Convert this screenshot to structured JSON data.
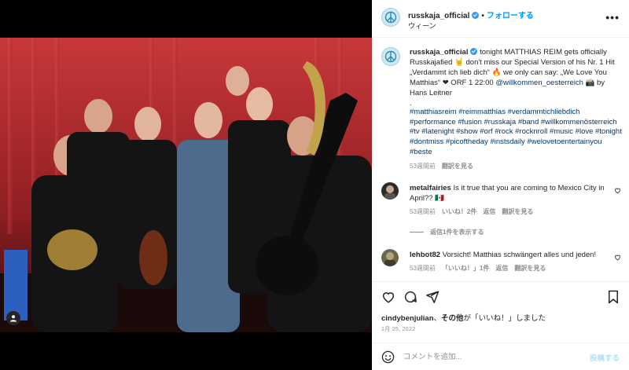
{
  "header": {
    "username": "russkaja_official",
    "follow_label": "フォローする",
    "location": "ウィーン",
    "more_label": "•••"
  },
  "caption": {
    "username": "russkaja_official",
    "text1": "tonight MATTHIAS REIM gets officially Russkajafied 🤘 don't miss our Special Version of his Nr. 1 Hit „Verdammt ich lieb dich“ 🔥 we only can say: „We Love You Matthias“ ❤ ORF 1 22:00 ",
    "mention": "@willkommen_oesterreich",
    "text2": " 📸 by Hans Leitner",
    "dot": ".",
    "hashtags": "#matthiasreim #reimmatthias #verdammtichliebdich #performance #fusion #russkaja #band #willkommenösterreich #tv #latenight #show #orf #rock #rocknroll #music #love #tonight #dontmiss #picoftheday #instsdaily #welovetoentertainyou #beste",
    "time": "53週間前",
    "translate": "翻訳を見る"
  },
  "comments": [
    {
      "username": "metalfairies",
      "text": "Is it true that you are coming to Mexico City in April?? 🇲🇽",
      "time": "53週間前",
      "likes": "いいね！2件",
      "reply": "返信",
      "translate": "翻訳を見る"
    },
    {
      "username": "lehbot82",
      "text": "Vorsicht! Matthias schwängert alles und jeden!",
      "time": "53週間前",
      "likes": "「いいね！」1件",
      "reply": "返信",
      "translate": "翻訳を見る"
    }
  ],
  "view_replies": "返信1件を表示する",
  "likes_line": {
    "user": "cindybenjulian",
    "mid": "、",
    "others": "その他",
    "suffix": "が「いいね！」しました"
  },
  "date": "1月 25, 2022",
  "comment_input": {
    "placeholder": "コメントを追加..."
  },
  "post_label": "投稿する",
  "colors": {
    "accent": "#0095f6",
    "link": "#00376b",
    "muted": "#8e8e8e",
    "stage_red": "#b3262b"
  }
}
